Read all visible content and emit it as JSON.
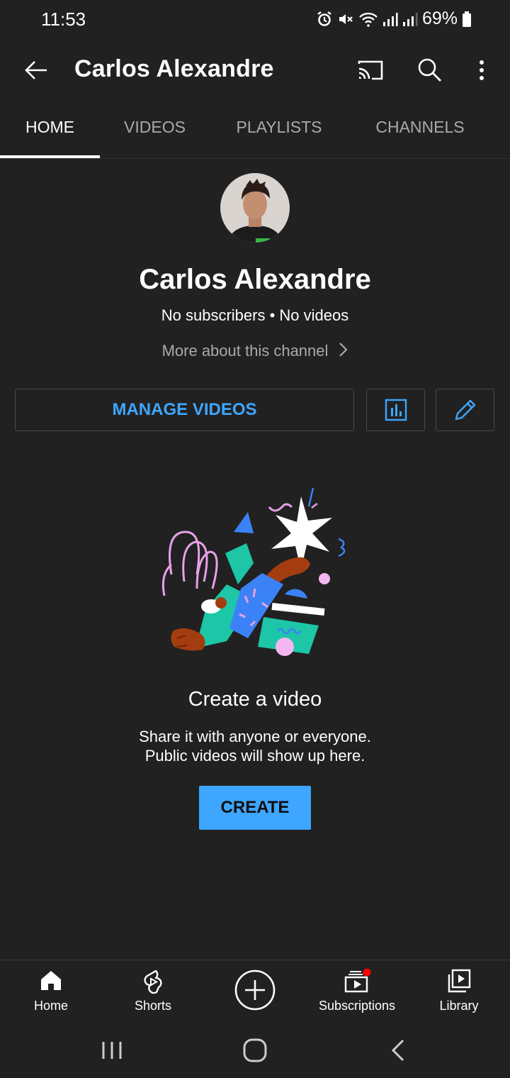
{
  "status_bar": {
    "time": "11:53",
    "battery": "69%"
  },
  "header": {
    "title": "Carlos Alexandre"
  },
  "tabs": [
    {
      "label": "HOME",
      "active": true
    },
    {
      "label": "VIDEOS",
      "active": false
    },
    {
      "label": "PLAYLISTS",
      "active": false
    },
    {
      "label": "CHANNELS",
      "active": false
    }
  ],
  "profile": {
    "name": "Carlos Alexandre",
    "stats": "No subscribers • No videos",
    "more_about": "More about this channel"
  },
  "actions": {
    "manage_videos": "MANAGE VIDEOS"
  },
  "empty_state": {
    "title": "Create a video",
    "line1": "Share it with anyone or everyone.",
    "line2": "Public videos will show up here.",
    "create_label": "CREATE"
  },
  "bottom_nav": [
    {
      "label": "Home",
      "icon": "home-icon"
    },
    {
      "label": "Shorts",
      "icon": "shorts-icon"
    },
    {
      "label": "",
      "icon": "create-plus-icon"
    },
    {
      "label": "Subscriptions",
      "icon": "subscriptions-icon",
      "has_notification_dot": true
    },
    {
      "label": "Library",
      "icon": "library-icon"
    }
  ],
  "colors": {
    "background": "#212121",
    "accent": "#3ea6ff",
    "notification": "#ff0000"
  }
}
